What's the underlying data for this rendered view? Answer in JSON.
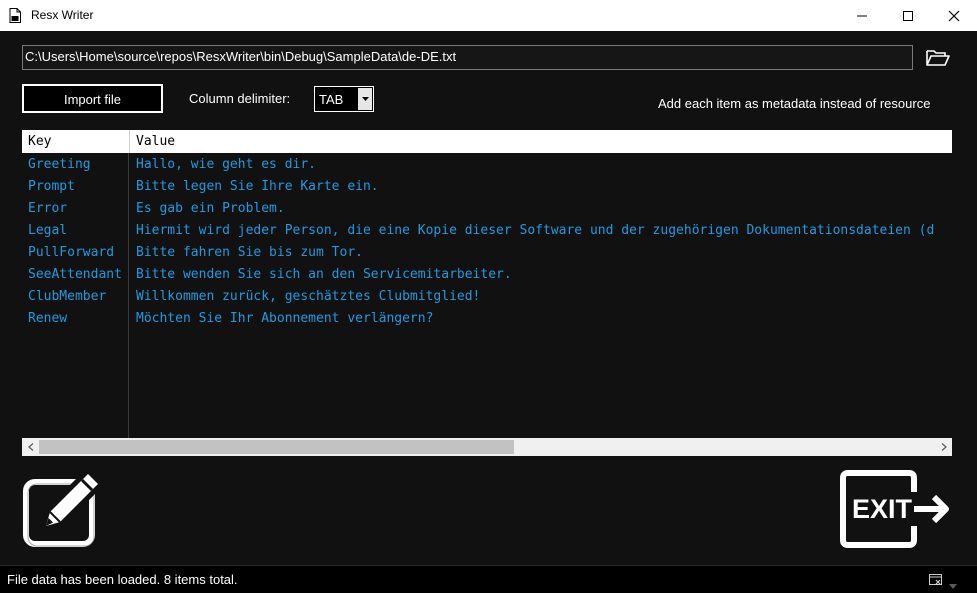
{
  "window": {
    "title": "Resx Writer",
    "minimize_label": "─",
    "maximize_label": "□",
    "close_label": "✕"
  },
  "path": {
    "value": "C:\\Users\\Home\\source\\repos\\ResxWriter\\bin\\Debug\\SampleData\\de-DE.txt"
  },
  "controls": {
    "import_label": "Import file",
    "delimiter_label": "Column delimiter:",
    "delimiter_value": "TAB",
    "metadata_label": "Add each item as metadata instead of resource"
  },
  "grid": {
    "headers": {
      "key": "Key",
      "value": "Value"
    },
    "rows": [
      {
        "key": "Greeting",
        "value": "Hallo, wie geht es dir."
      },
      {
        "key": "Prompt",
        "value": "Bitte legen Sie Ihre Karte ein."
      },
      {
        "key": "Error",
        "value": "Es gab ein Problem."
      },
      {
        "key": "Legal",
        "value": "Hiermit wird jeder Person, die eine Kopie dieser Software und der zugehörigen Dokumentationsdateien (d"
      },
      {
        "key": "PullForward",
        "value": "Bitte fahren Sie bis zum Tor."
      },
      {
        "key": "SeeAttendant",
        "value": "Bitte wenden Sie sich an den Servicemitarbeiter."
      },
      {
        "key": "ClubMember",
        "value": "Willkommen zurück, geschätztes Clubmitglied!"
      },
      {
        "key": "Renew",
        "value": "Möchten Sie Ihr Abonnement verlängern?"
      }
    ],
    "scroll_position": 0,
    "scroll_visible_fraction": 0.53
  },
  "actions": {
    "exit_label": "EXIT"
  },
  "status": {
    "text": "File data has been loaded.  8 items total."
  },
  "colors": {
    "background": "#111111",
    "accent_text": "#1e9ae0",
    "foreground": "#ffffff"
  }
}
